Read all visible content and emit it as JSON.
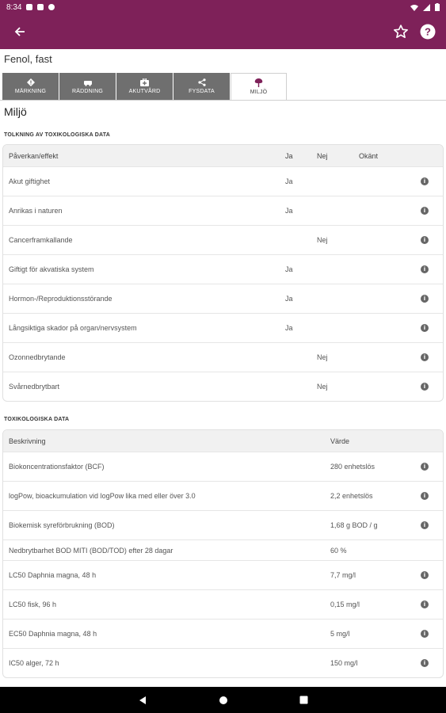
{
  "status": {
    "time": "8:34"
  },
  "substance": "Fenol, fast",
  "tabs": [
    {
      "label": "MÄRKNING",
      "icon": "warning-diamond-icon"
    },
    {
      "label": "RÄDDNING",
      "icon": "vehicle-icon"
    },
    {
      "label": "AKUTVÅRD",
      "icon": "first-aid-kit-icon"
    },
    {
      "label": "FYSDATA",
      "icon": "share-nodes-icon"
    },
    {
      "label": "MILJÖ",
      "icon": "tree-icon"
    }
  ],
  "section_title": "Miljö",
  "tolkning": {
    "header": "TOLKNING AV TOXIKOLOGISKA DATA",
    "columns": {
      "effect": "Påverkan/effekt",
      "ja": "Ja",
      "nej": "Nej",
      "okant": "Okänt"
    },
    "rows": [
      {
        "effect": "Akut giftighet",
        "ja": "Ja",
        "nej": "",
        "okant": ""
      },
      {
        "effect": "Anrikas i naturen",
        "ja": "Ja",
        "nej": "",
        "okant": ""
      },
      {
        "effect": "Cancerframkallande",
        "ja": "",
        "nej": "Nej",
        "okant": ""
      },
      {
        "effect": "Giftigt för akvatiska system",
        "ja": "Ja",
        "nej": "",
        "okant": ""
      },
      {
        "effect": "Hormon-/Reproduktionsstörande",
        "ja": "Ja",
        "nej": "",
        "okant": ""
      },
      {
        "effect": "Långsiktiga skador på organ/nervsystem",
        "ja": "Ja",
        "nej": "",
        "okant": ""
      },
      {
        "effect": "Ozonnedbrytande",
        "ja": "",
        "nej": "Nej",
        "okant": ""
      },
      {
        "effect": "Svårnedbrytbart",
        "ja": "",
        "nej": "Nej",
        "okant": ""
      }
    ]
  },
  "toxdata": {
    "header": "TOXIKOLOGISKA DATA",
    "columns": {
      "desc": "Beskrivning",
      "value": "Värde"
    },
    "rows": [
      {
        "desc": "Biokoncentrationsfaktor (BCF)",
        "value": "280 enhetslös",
        "info": true
      },
      {
        "desc": "logPow, bioackumulation vid logPow lika med eller över 3.0",
        "value": "2,2 enhetslös",
        "info": true
      },
      {
        "desc": "Biokemisk syreförbrukning (BOD)",
        "value": "1,68 g BOD / g",
        "info": true
      },
      {
        "desc": "Nedbrytbarhet BOD MITI (BOD/TOD) efter 28 dagar",
        "value": "60 %",
        "info": false
      },
      {
        "desc": "LC50 Daphnia magna, 48 h",
        "value": "7,7 mg/l",
        "info": true
      },
      {
        "desc": "LC50 fisk, 96 h",
        "value": "0,15 mg/l",
        "info": true
      },
      {
        "desc": "EC50 Daphnia magna, 48 h",
        "value": "5 mg/l",
        "info": true
      },
      {
        "desc": "IC50 alger, 72 h",
        "value": "150 mg/l",
        "info": true
      }
    ]
  },
  "colors": {
    "brand": "#7e2159",
    "tab_inactive": "#6f6f6f"
  }
}
